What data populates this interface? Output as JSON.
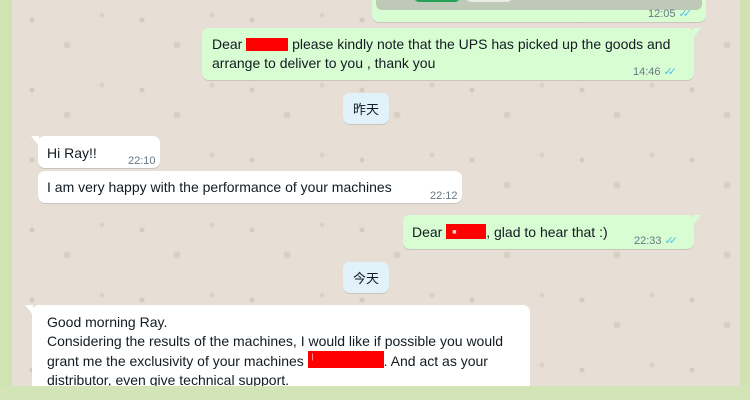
{
  "messages": [
    {
      "id": "prev-image",
      "direction": "out",
      "time": "12:05"
    },
    {
      "id": "ups-note",
      "direction": "out",
      "text_before": "Dear ",
      "text_after": " please kindly note that the UPS has picked up the goods and",
      "text_line2": "arrange to deliver to you , thank you",
      "time": "14:46"
    },
    {
      "id": "hi-ray",
      "direction": "in",
      "text": "Hi Ray!!",
      "time": "22:10"
    },
    {
      "id": "happy-performance",
      "direction": "in",
      "text": "I am very happy with the performance of your machines",
      "time": "22:12"
    },
    {
      "id": "glad",
      "direction": "out",
      "text_before": "Dear ",
      "text_after": ", glad to hear that :)",
      "time": "22:33"
    },
    {
      "id": "good-morning",
      "direction": "in",
      "line1": "Good morning Ray.",
      "line2": "Considering the results of the machines, I would like if possible you would",
      "line3_before": "grant me the exclusivity of your machines ",
      "line3_after": ". And act as your",
      "line4": "distributor, even give technical support."
    }
  ],
  "date_chips": {
    "yesterday": "昨天",
    "today": "今天"
  },
  "status": {
    "read_ticks": "✓✓"
  },
  "colors": {
    "outgoing_bubble": "#d9fdd3",
    "incoming_bubble": "#ffffff",
    "chat_background": "#e7dfd5",
    "date_chip": "#e1f2fb",
    "redaction": "#ff0000",
    "read_tick": "#53bdeb"
  },
  "icons": {
    "read_receipt": "double-check-icon"
  }
}
